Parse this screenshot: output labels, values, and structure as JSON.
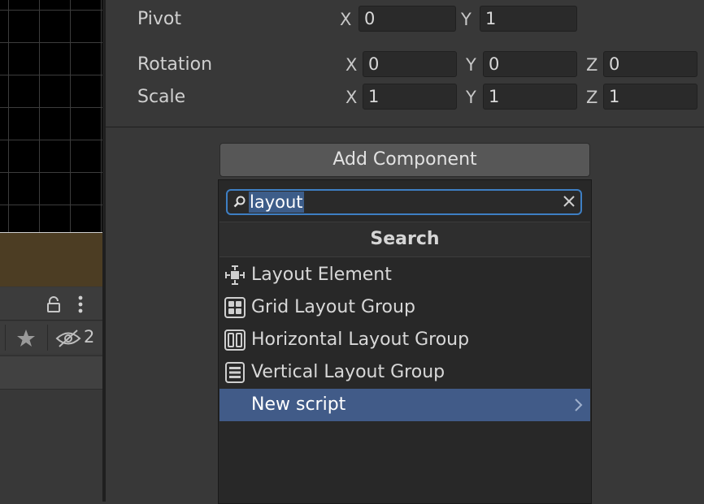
{
  "transform": {
    "pivot": {
      "label": "Pivot",
      "x_axis": "X",
      "x": "0",
      "y_axis": "Y",
      "y": "1"
    },
    "rotation": {
      "label": "Rotation",
      "x_axis": "X",
      "x": "0",
      "y_axis": "Y",
      "y": "0",
      "z_axis": "Z",
      "z": "0"
    },
    "scale": {
      "label": "Scale",
      "x_axis": "X",
      "x": "1",
      "y_axis": "Y",
      "y": "1",
      "z_axis": "Z",
      "z": "1"
    }
  },
  "add_component": {
    "button_label": "Add Component",
    "search_value": "layout",
    "header": "Search",
    "items": [
      {
        "label": "Layout Element",
        "icon": "layout-element-icon"
      },
      {
        "label": "Grid Layout Group",
        "icon": "grid-layout-icon"
      },
      {
        "label": "Horizontal Layout Group",
        "icon": "horizontal-layout-icon"
      },
      {
        "label": "Vertical Layout Group",
        "icon": "vertical-layout-icon"
      },
      {
        "label": "New script",
        "icon": "chevron-right-icon",
        "selected": true
      }
    ]
  },
  "left_panel": {
    "hidden_count": "2",
    "icons": [
      "lock-icon",
      "more-options-icon",
      "favorite-star-icon",
      "visibility-hidden-icon"
    ]
  },
  "colors": {
    "selection": "#415b88",
    "search_focus": "#3e7fc4",
    "scene_strip": "#4c3d23"
  }
}
